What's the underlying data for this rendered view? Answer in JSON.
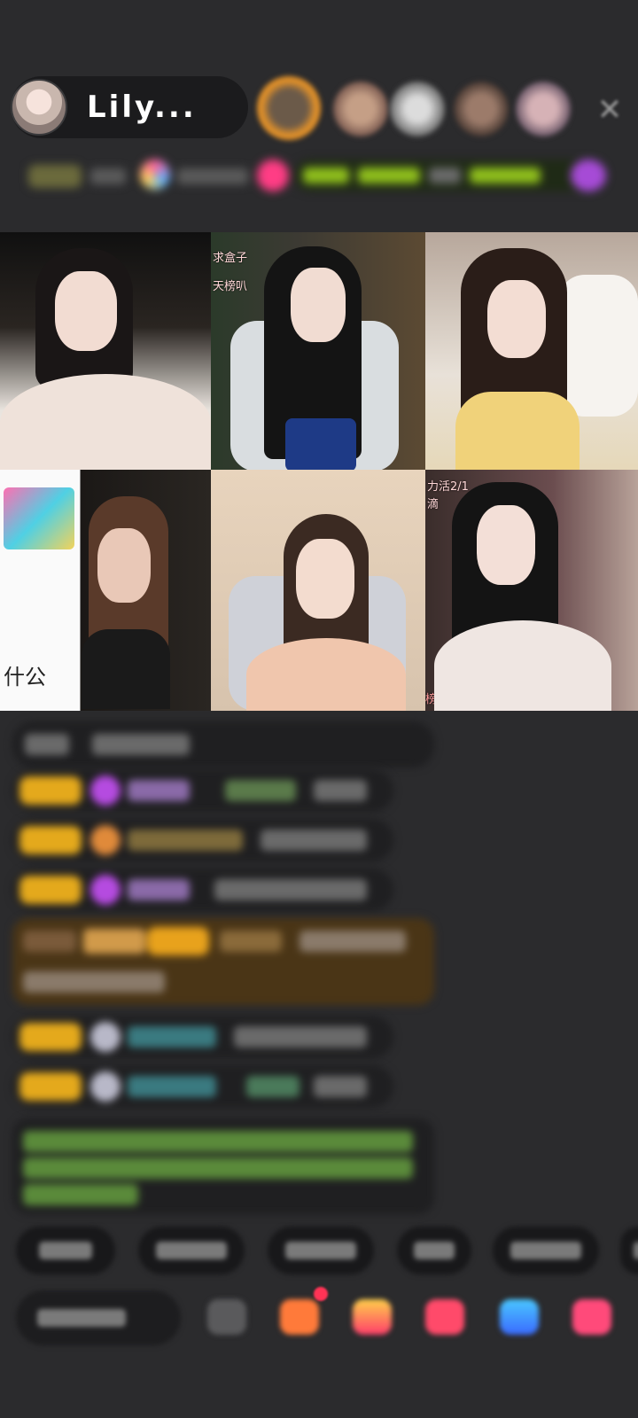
{
  "header": {
    "host_name": "Lily...",
    "close_icon": "close-icon"
  },
  "video_grid": {
    "cells": [
      {
        "overlay": ""
      },
      {
        "overlay": "求盒子"
      },
      {
        "overlay": "天榜叭"
      },
      {
        "overlay": ""
      },
      {
        "overlay": "什公"
      },
      {
        "overlay": "力活2/1"
      },
      {
        "overlay": "滴"
      },
      {
        "overlay": "榜叭"
      }
    ]
  },
  "colors": {
    "background": "#2b2b2d",
    "badge_gold": "#e4a91c",
    "chat_bubble": "#1f1f21",
    "accent_pink": "#ff4d8d"
  }
}
